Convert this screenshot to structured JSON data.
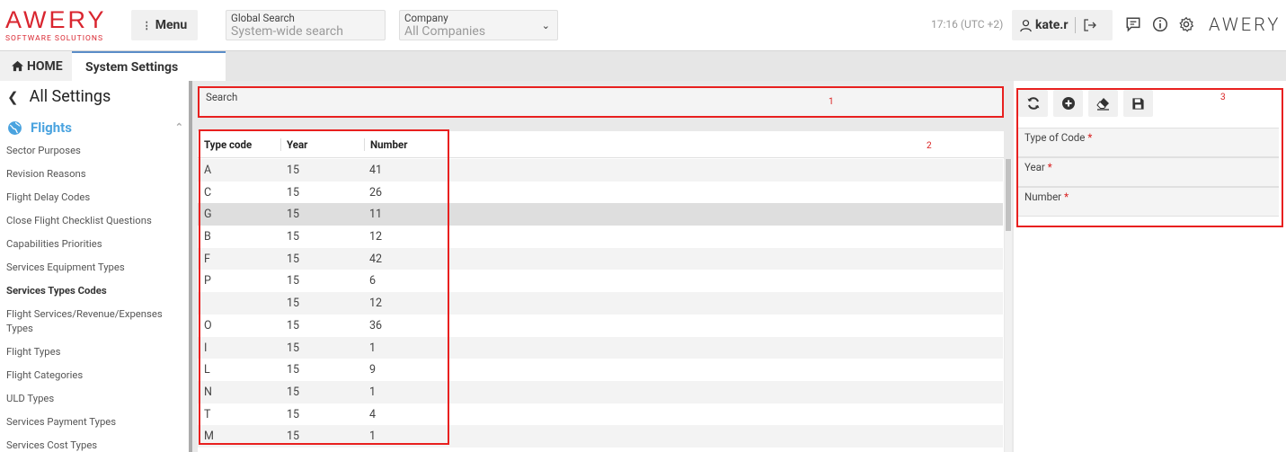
{
  "header": {
    "logo_word": "AWERY",
    "logo_sub": "SOFTWARE SOLUTIONS",
    "menu_label": "Menu",
    "global_search_label": "Global Search",
    "global_search_placeholder": "System-wide search",
    "company_label": "Company",
    "company_value": "All Companies",
    "time": "17:16 (UTC +2)",
    "user": "kate.r",
    "brand_right": "AWERY"
  },
  "tabs": {
    "home": "HOME",
    "active": "System Settings"
  },
  "sidebar": {
    "back_label": "All Settings",
    "section": "Flights",
    "items": [
      {
        "label": "Sector Purposes",
        "active": false
      },
      {
        "label": "Revision Reasons",
        "active": false
      },
      {
        "label": "Flight Delay Codes",
        "active": false
      },
      {
        "label": "Close Flight Checklist Questions",
        "active": false
      },
      {
        "label": "Capabilities Priorities",
        "active": false
      },
      {
        "label": "Services Equipment Types",
        "active": false
      },
      {
        "label": "Services Types Codes",
        "active": true
      },
      {
        "label": "Flight Services/Revenue/Expenses Types",
        "active": false
      },
      {
        "label": "Flight Types",
        "active": false
      },
      {
        "label": "Flight Categories",
        "active": false
      },
      {
        "label": "ULD Types",
        "active": false
      },
      {
        "label": "Services Payment Types",
        "active": false
      },
      {
        "label": "Services Cost Types",
        "active": false
      }
    ]
  },
  "main": {
    "search_label": "Search",
    "annotation_1": "1",
    "annotation_2": "2",
    "columns": [
      "Type code",
      "Year",
      "Number"
    ],
    "rows": [
      [
        "A",
        "15",
        "41"
      ],
      [
        "C",
        "15",
        "26"
      ],
      [
        "G",
        "15",
        "11"
      ],
      [
        "B",
        "15",
        "12"
      ],
      [
        "F",
        "15",
        "42"
      ],
      [
        "P",
        "15",
        "6"
      ],
      [
        "",
        "15",
        "12"
      ],
      [
        "O",
        "15",
        "36"
      ],
      [
        "I",
        "15",
        "1"
      ],
      [
        "L",
        "15",
        "9"
      ],
      [
        "N",
        "15",
        "1"
      ],
      [
        "T",
        "15",
        "4"
      ],
      [
        "M",
        "15",
        "1"
      ]
    ],
    "selected_row_index": 2
  },
  "form": {
    "annotation_3": "3",
    "fields": [
      {
        "label": "Type of Code",
        "required": "*"
      },
      {
        "label": "Year",
        "required": "*"
      },
      {
        "label": "Number",
        "required": "*"
      }
    ],
    "toolbar_icons": [
      "refresh-icon",
      "add-icon",
      "eraser-icon",
      "save-icon"
    ]
  }
}
